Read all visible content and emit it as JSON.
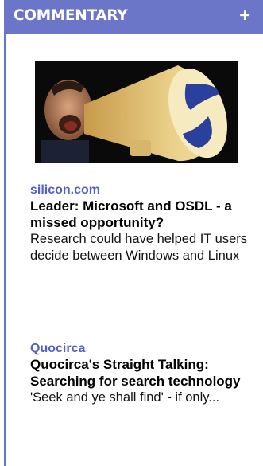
{
  "header": {
    "title": "COMMENTARY",
    "expand_label": "+"
  },
  "image": {
    "description_icon": "megaphone-shout-photo"
  },
  "articles": [
    {
      "source": "silicon.com",
      "headline": "Leader: Microsoft and OSDL - a missed opportunity?",
      "summary": "Research could have helped IT users decide between Windows and Linux"
    },
    {
      "source": "Quocirca",
      "headline": "Quocirca's Straight Talking: Searching for search technology",
      "summary": "'Seek and ye shall find' - if only..."
    }
  ],
  "colors": {
    "header_bg": "#6b76c9",
    "source_link": "#5461c2",
    "text": "#000000"
  }
}
